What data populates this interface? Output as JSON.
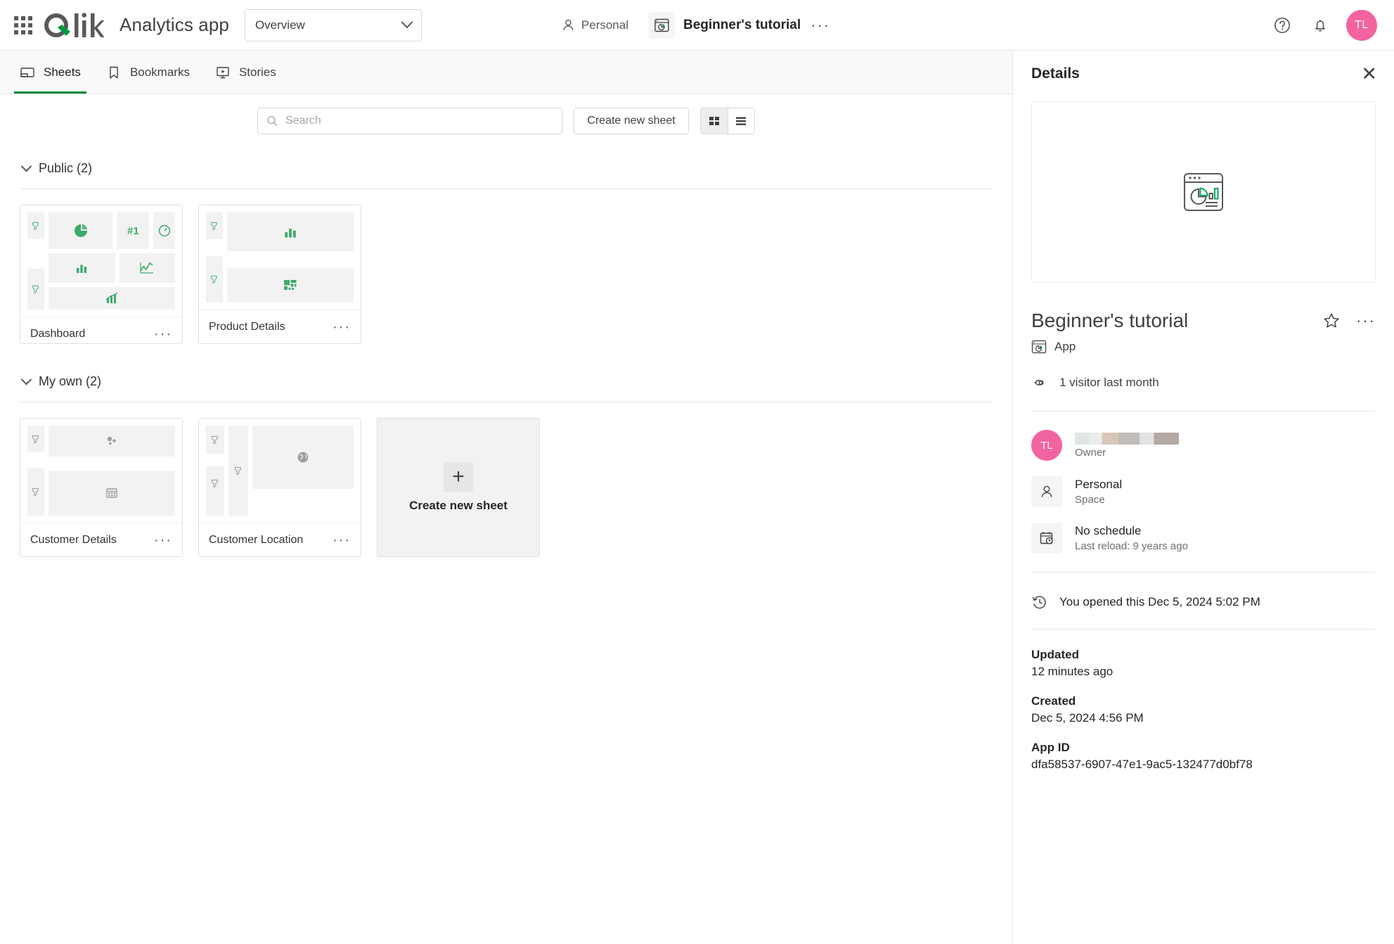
{
  "header": {
    "app_kind": "Analytics app",
    "sheet_selector_value": "Overview",
    "breadcrumb_space": "Personal",
    "breadcrumb_app": "Beginner's tutorial",
    "overflow_label": "···",
    "help_icon": "question-circle-icon",
    "notification_icon": "bell-icon",
    "avatar_initials": "TL",
    "avatar_color": "#f2649f"
  },
  "tabs": [
    {
      "label": "Sheets",
      "icon": "sheet-icon",
      "active": true
    },
    {
      "label": "Bookmarks",
      "icon": "bookmark-icon",
      "active": false
    },
    {
      "label": "Stories",
      "icon": "story-icon",
      "active": false
    }
  ],
  "toolbar": {
    "search_placeholder": "Search",
    "search_value": "",
    "create_sheet_label": "Create new sheet",
    "grid_view_active": true,
    "list_view_active": false
  },
  "sections": [
    {
      "title": "Public (2)",
      "sheets": [
        {
          "name": "Dashboard",
          "kebab": "···"
        },
        {
          "name": "Product Details",
          "kebab": "···"
        }
      ]
    },
    {
      "title": "My own (2)",
      "sheets": [
        {
          "name": "Customer Details",
          "kebab": "···"
        },
        {
          "name": "Customer Location",
          "kebab": "···"
        }
      ],
      "create_tile_label": "Create new sheet",
      "create_tile_plus": "+"
    }
  ],
  "details": {
    "panel_title": "Details",
    "close_label": "✕",
    "app_name": "Beginner's tutorial",
    "app_type": "App",
    "star_icon": "star-outline-icon",
    "kebab": "···",
    "visitors": "1 visitor last month",
    "owner": {
      "avatar_initials": "TL",
      "role_label": "Owner"
    },
    "space": {
      "name": "Personal",
      "sub": "Space"
    },
    "schedule": {
      "name": "No schedule",
      "sub": "Last reload: 9 years ago"
    },
    "opened": "You opened this Dec 5, 2024 5:02 PM",
    "updated_label": "Updated",
    "updated_value": "12 minutes ago",
    "created_label": "Created",
    "created_value": "Dec 5, 2024 4:56 PM",
    "app_id_label": "App ID",
    "app_id_value": "dfa58537-6907-47e1-9ac5-132477d0bf78"
  },
  "colors": {
    "qlik_green": "#009845",
    "accent_green": "#00873d",
    "chart_green": "#61b884",
    "avatar_pink": "#f2649f"
  }
}
